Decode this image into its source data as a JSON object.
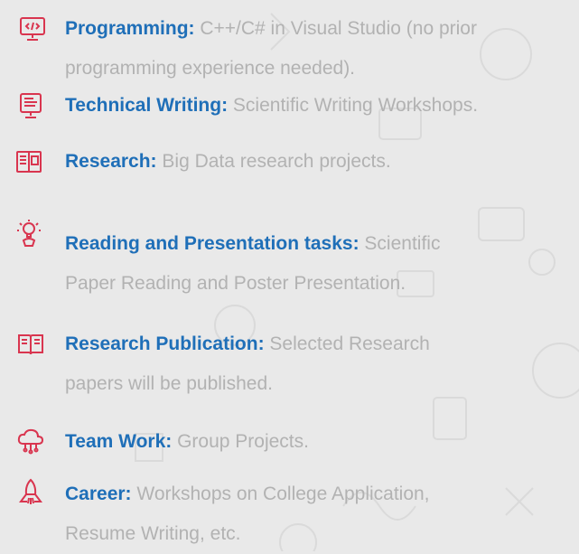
{
  "items": [
    {
      "icon": "code-monitor-icon",
      "label": "Programming:",
      "desc_line1": " C++/C# in Visual Studio (no prior",
      "desc_line2": "programming experience needed)."
    },
    {
      "icon": "document-monitor-icon",
      "label": "Technical Writing:",
      "desc_line1": " Scientific Writing Workshops.",
      "desc_line2": ""
    },
    {
      "icon": "research-book-icon",
      "label": "Research:",
      "desc_line1": " Big Data research projects.",
      "desc_line2": ""
    },
    {
      "icon": "idea-hand-icon",
      "label": "Reading and Presentation tasks:",
      "desc_line1": " Scientific",
      "desc_line2": "Paper Reading and Poster Presentation."
    },
    {
      "icon": "open-book-icon",
      "label": "Research Publication:",
      "desc_line1": " Selected Research",
      "desc_line2": "papers will be published."
    },
    {
      "icon": "cloud-network-icon",
      "label": "Team Work:",
      "desc_line1": " Group Projects.",
      "desc_line2": ""
    },
    {
      "icon": "rocket-icon",
      "label": "Career:",
      "desc_line1": " Workshops on College Application,",
      "desc_line2": "Resume Writing, etc."
    }
  ],
  "colors": {
    "label": "#1f6fb8",
    "text": "#b2b2b2",
    "icon": "#d9354f",
    "background": "#e9e9e9"
  }
}
